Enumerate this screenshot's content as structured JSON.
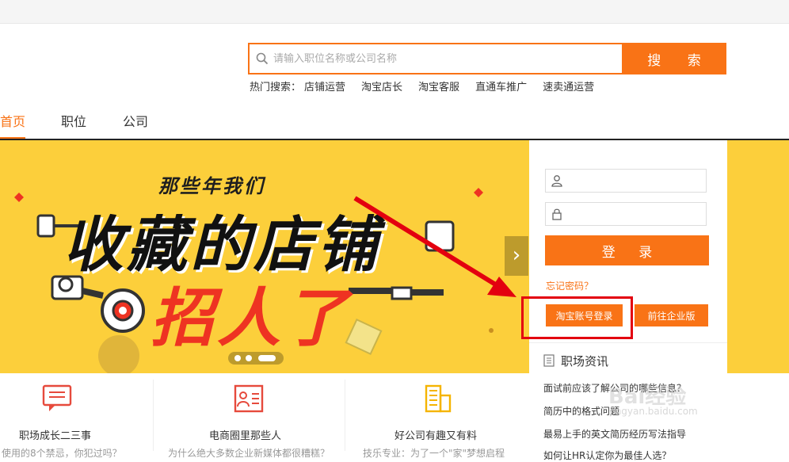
{
  "search": {
    "placeholder": "请输入职位名称或公司名称",
    "button_label": "搜 索",
    "hot_label": "热门搜索：",
    "hot_terms": [
      "店铺运营",
      "淘宝店长",
      "淘宝客服",
      "直通车推广",
      "速卖通运营"
    ]
  },
  "nav": {
    "items": [
      "首页",
      "职位",
      "公司"
    ],
    "active": "首页"
  },
  "banner": {
    "title_small": "那些年我们",
    "title_big": "收藏的店铺",
    "title_red": "招人了",
    "next_icon": "chevron-right-icon"
  },
  "login": {
    "username_placeholder": "",
    "password_placeholder": "",
    "login_label": "登 录",
    "forgot_label": "忘记密码？",
    "taobao_login_label": "淘宝账号登录",
    "enterprise_label": "前往企业版"
  },
  "news": {
    "title": "职场资讯",
    "items": [
      "面试前应该了解公司的哪些信息？",
      "简历中的格式问题",
      "最易上手的英文简历经历写法指导",
      "如何让HR认定你为最佳人选？"
    ]
  },
  "cards": [
    {
      "title": "职场成长二三事",
      "sub": "使用的8个禁忌，你犯过吗？"
    },
    {
      "title": "电商圈里那些人",
      "sub": "为什么绝大多数企业新媒体都很糟糕？"
    },
    {
      "title": "好公司有趣又有料",
      "sub": "技乐专业：为了一个\"家\"梦想启程"
    }
  ],
  "watermark": {
    "text": "Bai经验",
    "sub": "jingyan.baidu.com"
  },
  "colors": {
    "accent": "#f97316",
    "banner": "#fccf3b",
    "highlight": "#e3000f"
  }
}
